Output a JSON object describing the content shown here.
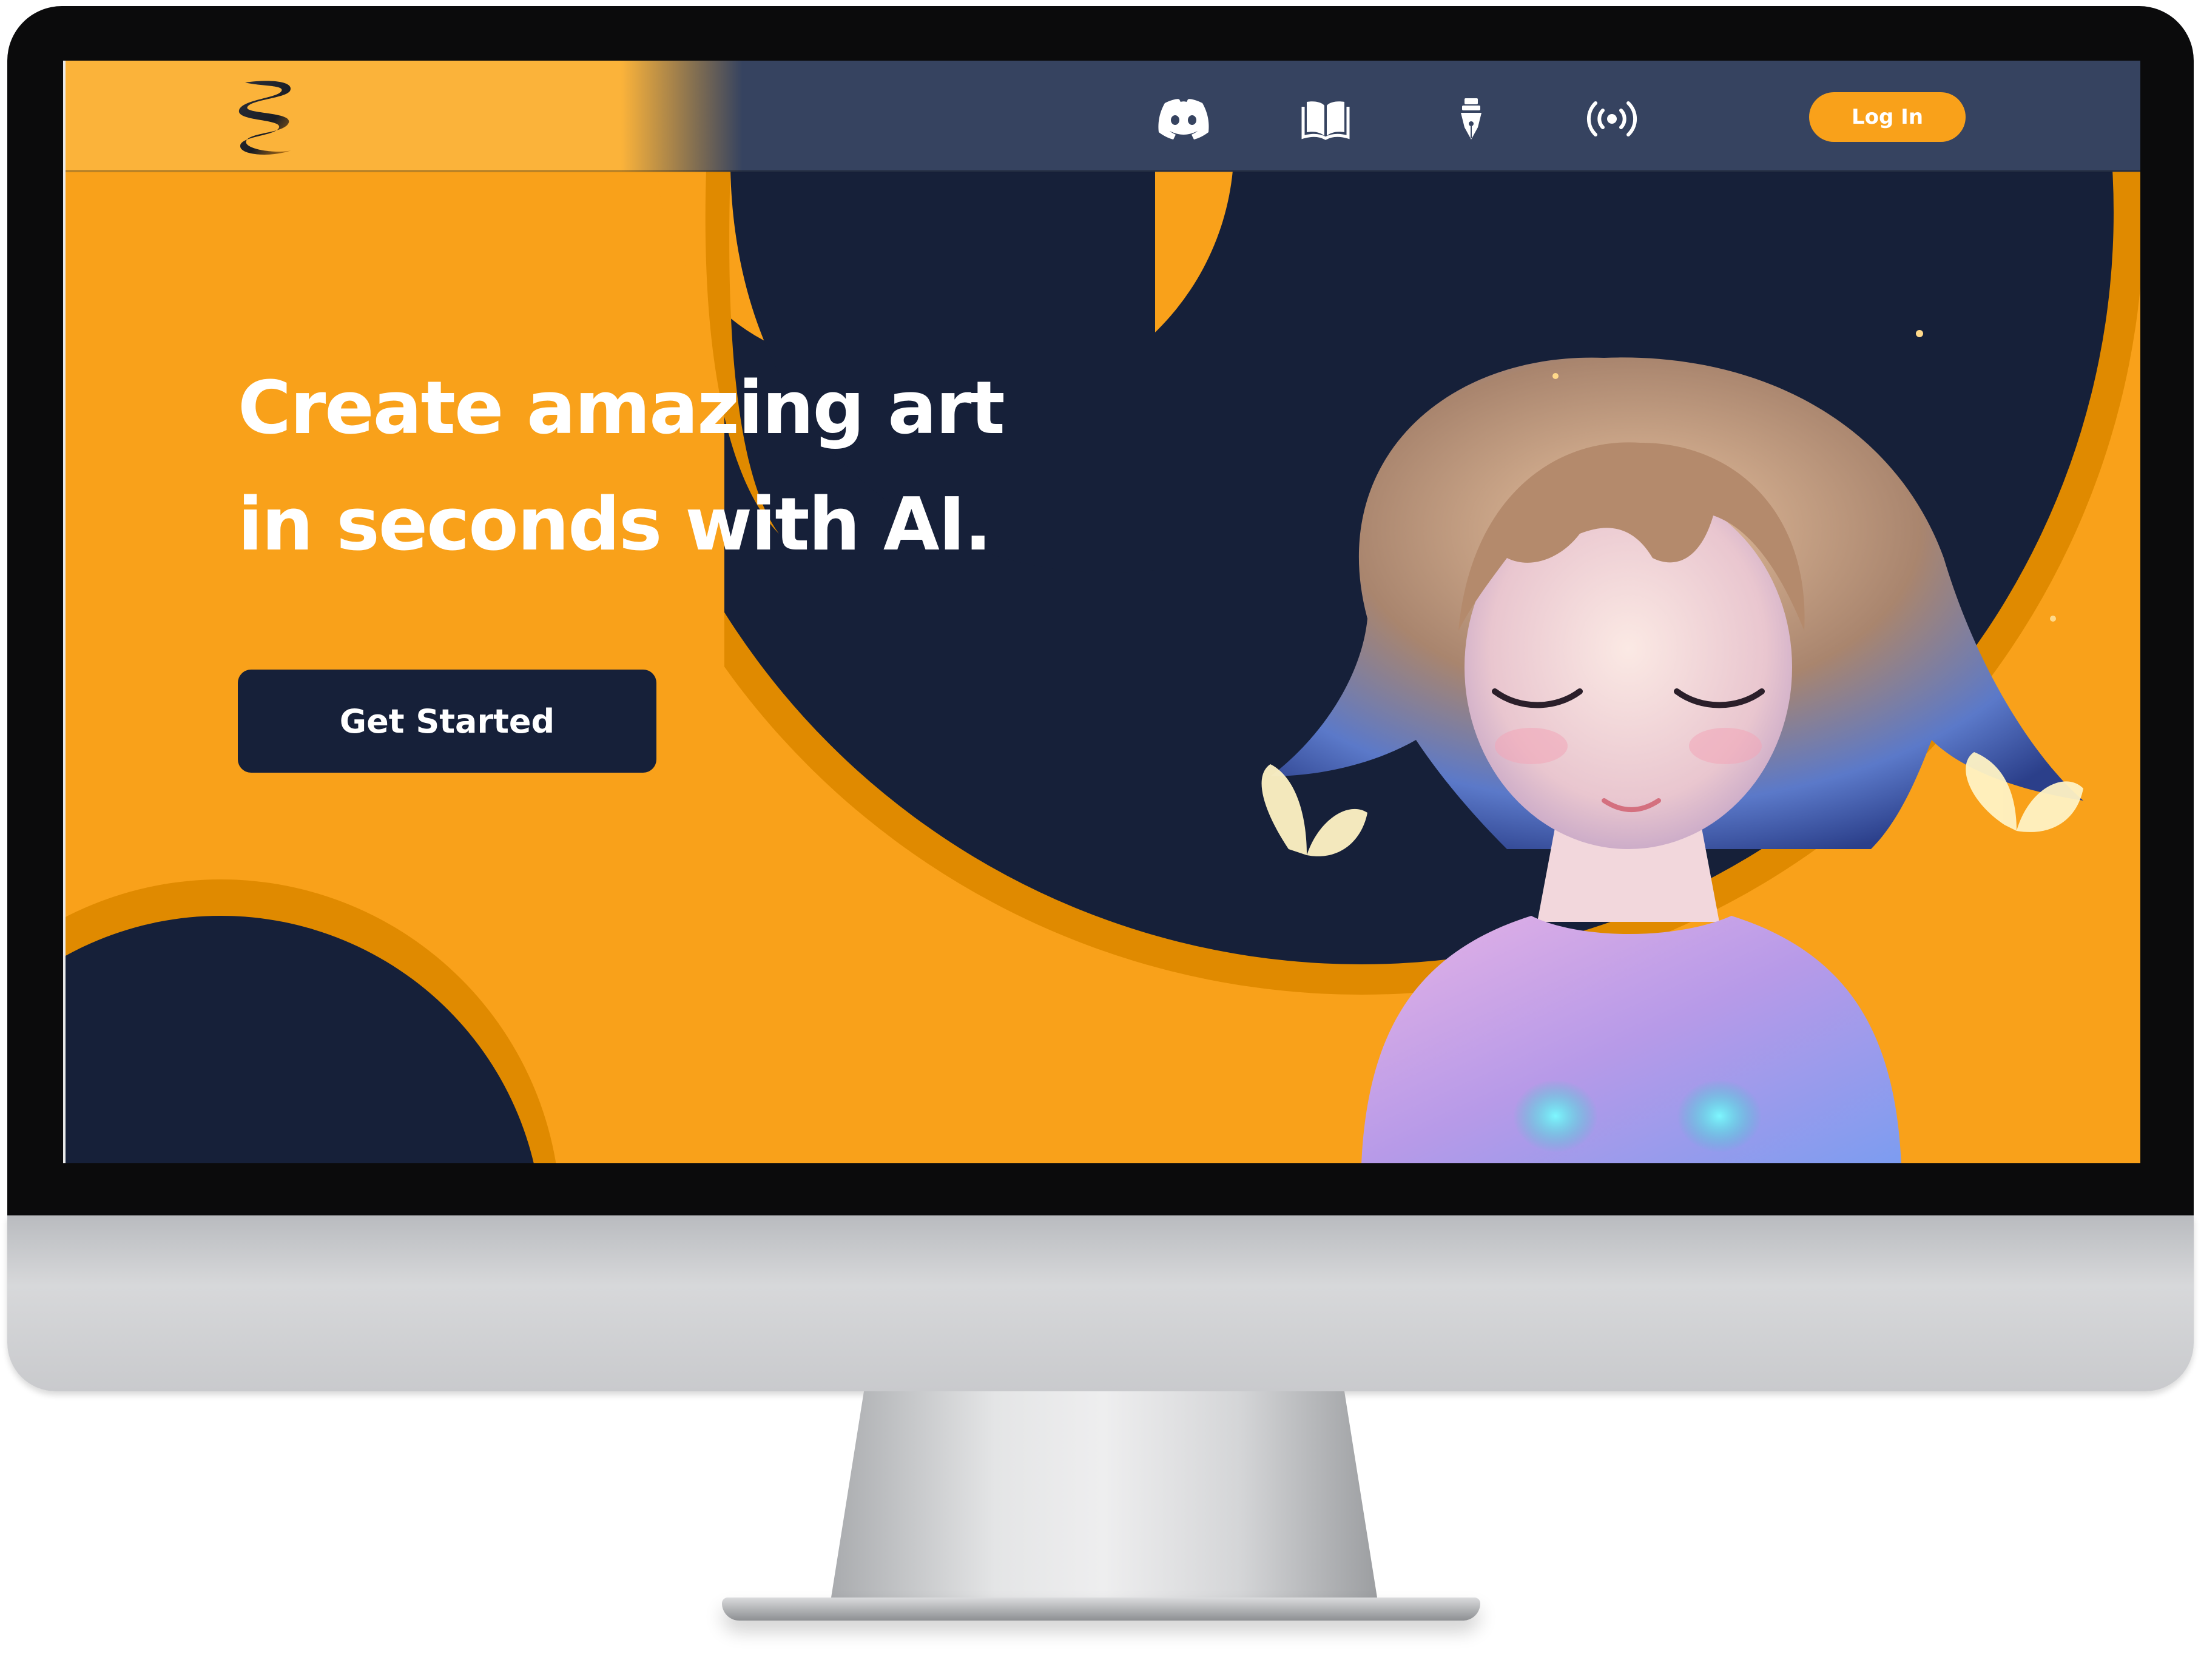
{
  "nav": {
    "logo": "stacked-s-logo",
    "icons": [
      {
        "name": "discord-icon"
      },
      {
        "name": "book-icon"
      },
      {
        "name": "pen-nib-icon"
      },
      {
        "name": "broadcast-icon"
      }
    ],
    "login_label": "Log In"
  },
  "hero": {
    "headline_line1": "Create amazing art",
    "headline_line2": "in seconds with AI.",
    "cta_label": "Get Started",
    "image": "anime-girl-with-butterflies-illustration"
  },
  "colors": {
    "orange": "#f9a11a",
    "orange_dark": "#e08a00",
    "navy": "#162039",
    "nav_slate": "#364360",
    "logo_orange": "#fbb33a"
  }
}
